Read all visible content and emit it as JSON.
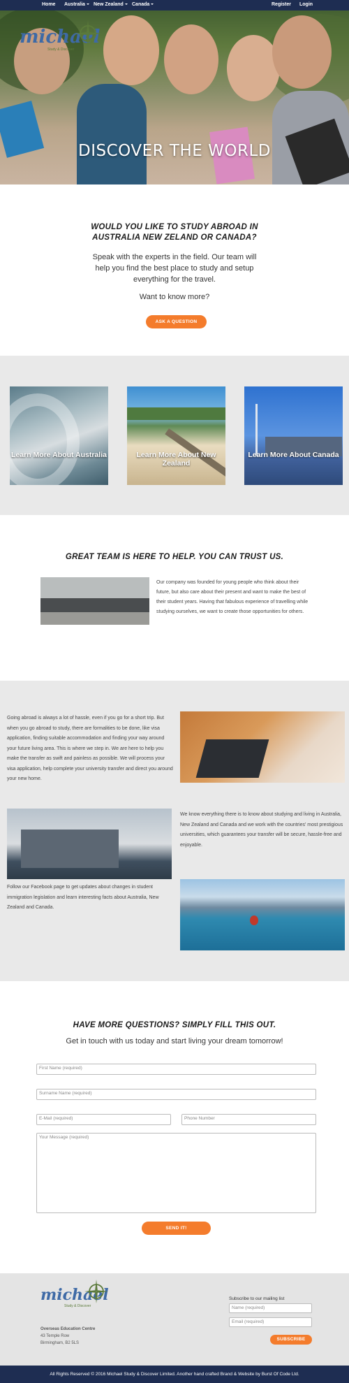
{
  "nav": {
    "home": "Home",
    "australia": "Australia",
    "new_zealand": "New Zealand",
    "canada": "Canada",
    "register": "Register",
    "login": "Login"
  },
  "hero": {
    "logo_text": "michael",
    "logo_sub": "Study & Discover",
    "title": "DISCOVER THE WORLD"
  },
  "intro": {
    "heading": "WOULD YOU LIKE TO STUDY ABROAD IN AUSTRALIA NEW ZELAND OR CANADA?",
    "text": "Speak with the experts in the field. Our team will help you find the best place to study and setup everything for the travel.",
    "want": "Want to know more?",
    "button": "ASK A QUESTION"
  },
  "countries": [
    {
      "label": "Learn More About Australia"
    },
    {
      "label": "Learn More About New Zealand"
    },
    {
      "label": "Learn More About Canada"
    }
  ],
  "team": {
    "heading": "GREAT TEAM IS HERE TO HELP. YOU CAN TRUST US.",
    "text": "Our company was founded for young people who think about their future, but also care about their present and want to make the best of their student years. Having that fabulous experience of travelling while studying ourselves, we want to create those opportunities for others."
  },
  "abroad": {
    "p1": "Going abroad is always a lot of hassle, even if you go for a short trip. But when you go abroad to study, there are formalities to be done, like visa application, finding suitable accommodation and finding your way around your future living area. This is where we step in. We are here to help you make the transfer as swift and painless as possible. We will process your visa application, help complete your university transfer and direct you around your new home.",
    "p2": "We know everything there is to know about studying and living in Australia, New Zealand and Canada and we work with the countries' most prestigious universities, which guarantees your transfer will be secure, hassle-free and enjoyable.",
    "p3": "Follow our Facebook page to get updates about changes in student immigration legislation and learn interesting facts about Australia, New Zealand and Canada."
  },
  "form": {
    "heading": "HAVE MORE QUESTIONS? SIMPLY FILL THIS OUT.",
    "sub": "Get in touch with us today and start living your dream tomorrow!",
    "first_name": "First Name (required)",
    "surname": "Surname Name (required)",
    "email": "E-Mail (required)",
    "phone": "Phone Number",
    "message": "Your Message (required)",
    "send": "SEND IT!"
  },
  "footer": {
    "logo_text": "michael",
    "logo_sub": "Study & Discover",
    "centre": "Overseas Education Centre",
    "addr1": "43 Temple Row",
    "addr2": "Birmingham, B2 5LS",
    "subscribe_label": "Subscribe to our mailing list",
    "name_placeholder": "Name (required)",
    "email_placeholder": "Email (required)",
    "subscribe_button": "SUBSCRIBE",
    "copyright": "All Rights Reserved © 2016 Michael Study & Discover Limited. Another hand crafted Brand & Website by Burst Of Code Ltd."
  },
  "colors": {
    "nav": "#1e2d52",
    "accent": "#f47c2c",
    "band": "#e9e9e9"
  }
}
